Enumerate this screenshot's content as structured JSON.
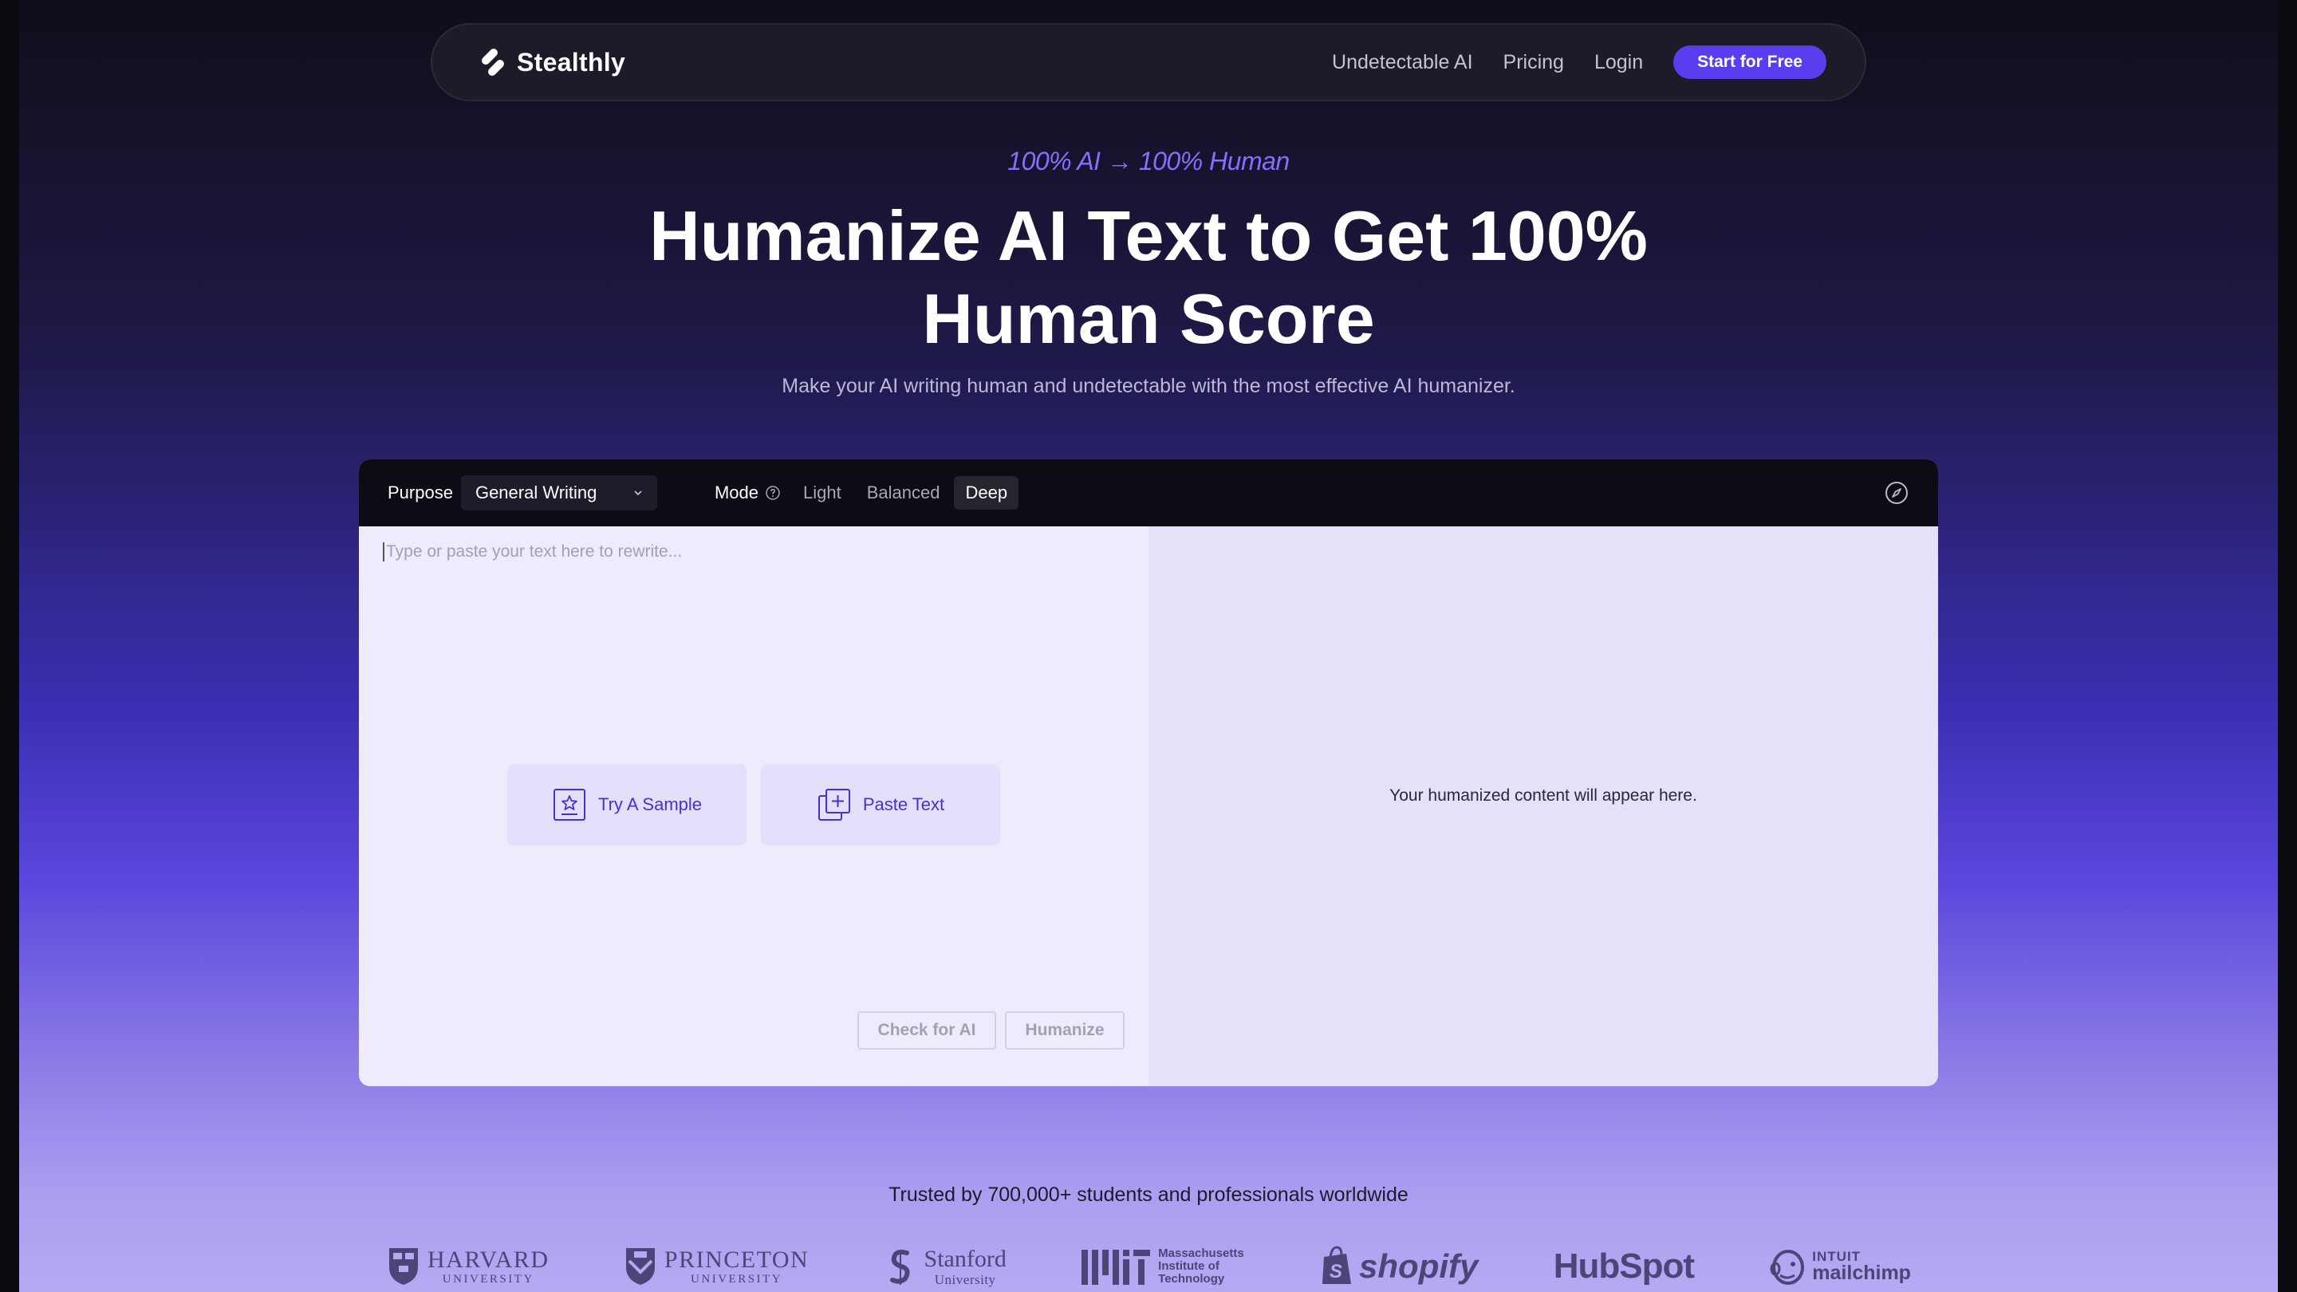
{
  "nav": {
    "brand": "Stealthly",
    "links": [
      "Undetectable AI",
      "Pricing",
      "Login"
    ],
    "cta": "Start for Free"
  },
  "hero": {
    "eyebrow": "100% AI → 100% Human",
    "title_line1": "Humanize AI Text to Get 100%",
    "title_line2": "Human Score",
    "subtitle": "Make your AI writing human and undetectable with the most effective AI humanizer."
  },
  "editor": {
    "purpose_label": "Purpose",
    "purpose_value": "General Writing",
    "mode_label": "Mode",
    "modes": [
      "Light",
      "Balanced",
      "Deep"
    ],
    "active_mode": "Deep",
    "input_placeholder": "Type or paste your text here to rewrite...",
    "try_sample": "Try A Sample",
    "paste_text": "Paste Text",
    "check_button": "Check for AI",
    "humanize_button": "Humanize",
    "output_hint": "Your humanized content will appear here."
  },
  "trusted": {
    "text": "Trusted by 700,000+ students and professionals worldwide",
    "logos": {
      "harvard_name": "HARVARD",
      "harvard_sub": "UNIVERSITY",
      "princeton_name": "PRINCETON",
      "princeton_sub": "UNIVERSITY",
      "stanford_name": "Stanford",
      "stanford_sub": "University",
      "mit_line1": "Massachusetts",
      "mit_line2": "Institute of",
      "mit_line3": "Technology",
      "shopify": "shopify",
      "hubspot": "HubSpot",
      "mailchimp_top": "INTUIT",
      "mailchimp_bottom": "mailchimp"
    }
  },
  "colors": {
    "accent": "#5b3df0",
    "eyebrow": "#8a6cff",
    "toolbar_bg": "#0d0c14",
    "editor_bg": "#efebfd"
  }
}
